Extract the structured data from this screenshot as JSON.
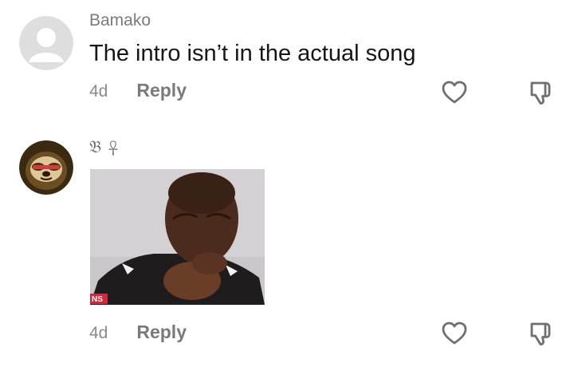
{
  "comments": [
    {
      "username": "Bamako",
      "text": "The intro isn’t in the actual song",
      "time": "4d",
      "reply_label": "Reply",
      "icons": {
        "avatar": "default-avatar-icon",
        "like": "heart-icon",
        "dislike": "thumbs-down-icon"
      }
    },
    {
      "username": "𝔅 ☥",
      "gif_watermark": "NS",
      "time": "4d",
      "reply_label": "Reply",
      "icons": {
        "avatar": "sloth-avatar",
        "like": "heart-icon",
        "dislike": "thumbs-down-icon"
      }
    }
  ],
  "colors": {
    "icon": "#6f6f6f",
    "gif_watermark_bg": "#d6283a"
  }
}
